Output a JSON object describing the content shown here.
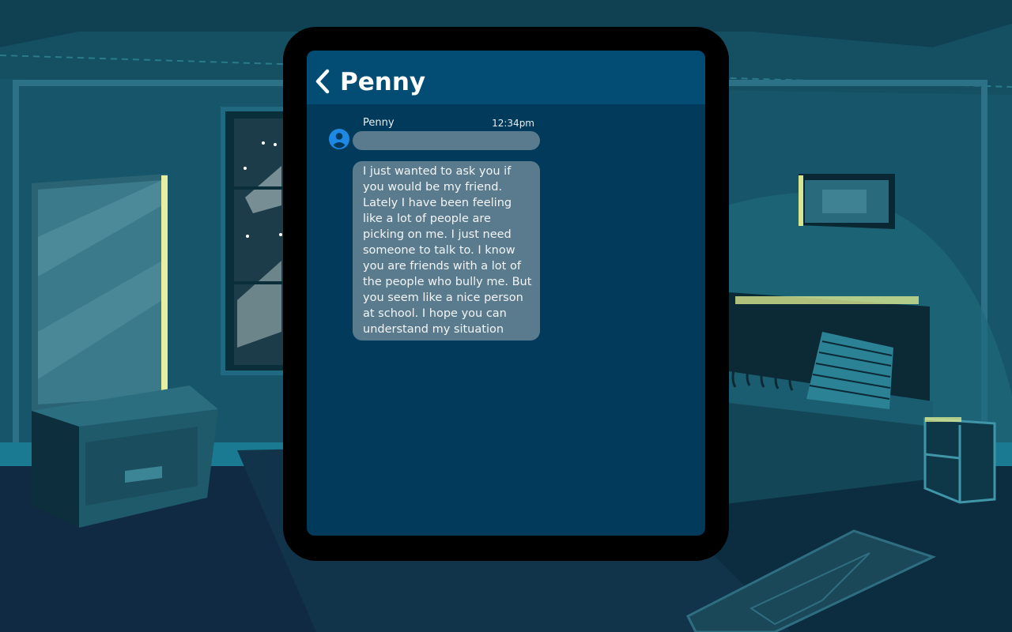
{
  "chat": {
    "contact_name": "Penny",
    "sender_name": "Penny",
    "timestamp": "12:34pm",
    "message": "I just wanted to ask you if you would be my friend. Lately I have been feeling like a lot of people are picking on me. I just need someone to talk to. I know you are friends with a lot of the people who bully me. But you seem like a nice person at school. I hope you can understand my situation",
    "typing_indicator": true
  },
  "icons": {
    "back": "chevron-left-icon",
    "avatar": "user-circle-icon"
  },
  "colors": {
    "header": "#034d75",
    "chat_background": "#013a5b",
    "bubble": "#5a7b8d",
    "avatar": "#1e88e5",
    "room_wall": "#1a5568"
  }
}
